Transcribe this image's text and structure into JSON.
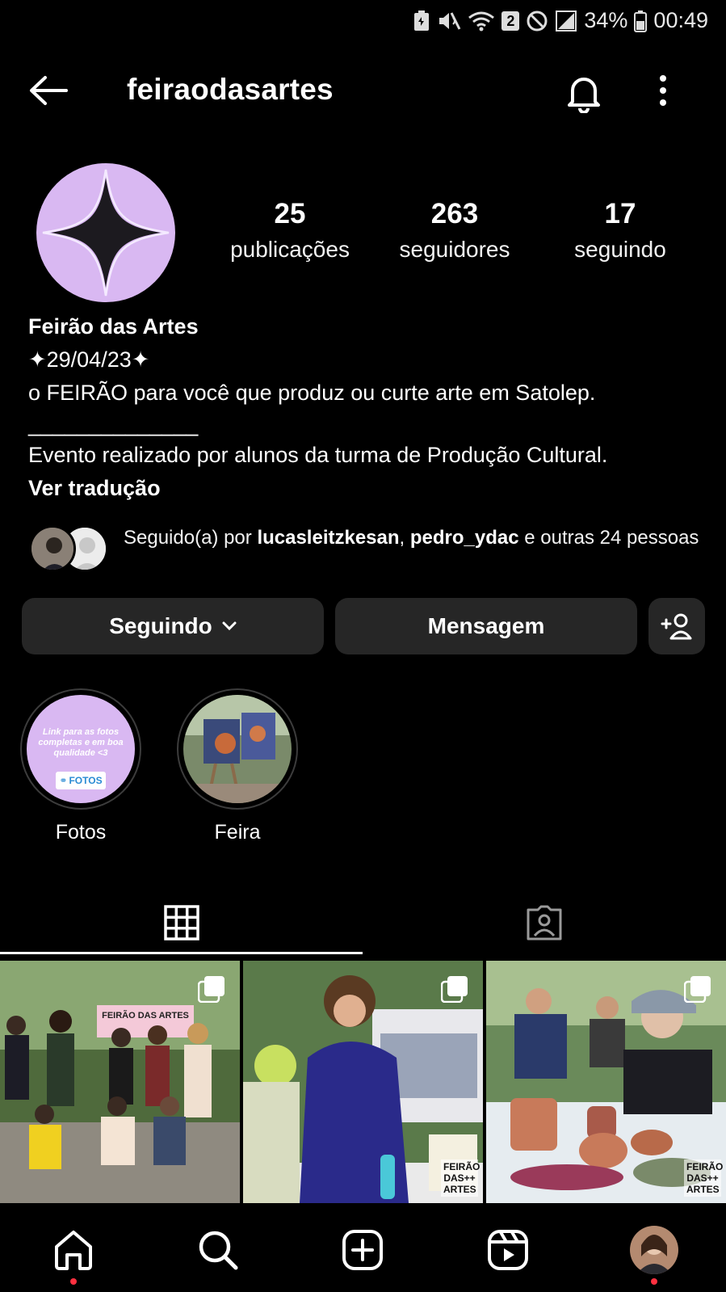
{
  "status_bar": {
    "battery": "34%",
    "time": "00:49",
    "sim_badge": "2"
  },
  "header": {
    "username": "feiraodasartes"
  },
  "stats": [
    {
      "value": "25",
      "label": "publicações"
    },
    {
      "value": "263",
      "label": "seguidores"
    },
    {
      "value": "17",
      "label": "seguindo"
    }
  ],
  "bio": {
    "name": "Feirão das Artes",
    "line1": "✦29/04/23✦",
    "line2": "o FEIRÃO para você que produz ou curte arte em Satolep.",
    "line3": "______________",
    "line4": "Evento realizado por alunos da turma de Produção Cultural.",
    "translate": "Ver tradução"
  },
  "followed_by": {
    "prefix": "Seguido(a) por ",
    "user1": "lucasleitzkesan",
    "sep": ", ",
    "user2": "pedro_ydac",
    "suffix": " e outras 24 pessoas"
  },
  "actions": {
    "following": "Seguindo",
    "message": "Mensagem"
  },
  "highlights": [
    {
      "label": "Fotos",
      "cover_text": "Link para as fotos completas e em boa qualidade <3",
      "cover_badge": "FOTOS"
    },
    {
      "label": "Feira"
    }
  ],
  "posts": [
    {
      "banner": "FEIRÃO DAS ARTES"
    },
    {
      "brand": "FEIRÃO DAS++ ARTES"
    },
    {
      "brand": "FEIRÃO DAS++ ARTES"
    }
  ],
  "colors": {
    "background": "#000000",
    "button": "#262626",
    "avatar_bg": "#d9b8f2",
    "notification_dot": "#ff3040"
  }
}
